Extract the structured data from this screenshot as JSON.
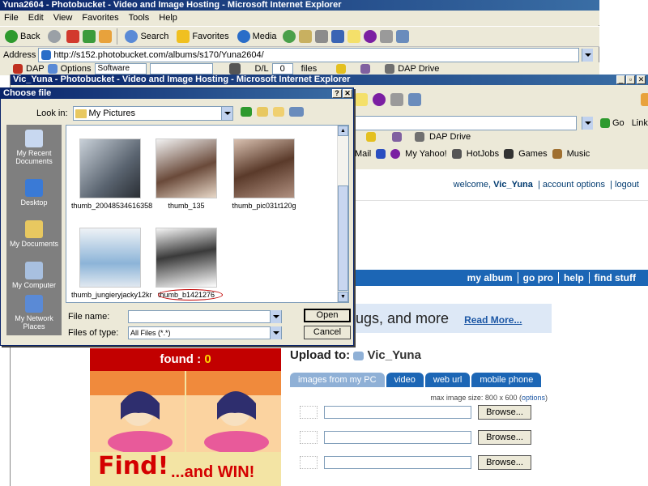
{
  "back_window": {
    "title": "Yuna2604 - Photobucket - Video and Image Hosting - Microsoft Internet Explorer",
    "menu": [
      "File",
      "Edit",
      "View",
      "Favorites",
      "Tools",
      "Help"
    ],
    "toolbar": {
      "back": "Back",
      "search": "Search",
      "favorites": "Favorites",
      "media": "Media"
    },
    "address_label": "Address",
    "address_url": "http://s152.photobucket.com/albums/s170/Yuna2604/",
    "links_bar": {
      "dap": "DAP",
      "options": "Options",
      "software": "Software",
      "dl": "D/L",
      "dl_count": "0",
      "files": "files",
      "dap_drive": "DAP Drive"
    }
  },
  "front_window": {
    "title": "Vic_Yuna - Photobucket - Video and Image Hosting - Microsoft Internet Explorer",
    "go": "Go",
    "links": "Links",
    "dap_drive": "DAP Drive",
    "favorites_bar": [
      "Mail",
      "My Yahoo!",
      "HotJobs",
      "Games",
      "Music"
    ],
    "page": {
      "welcome": "welcome,",
      "username": "Vic_Yuna",
      "account_options": "account options",
      "logout": "logout",
      "nav": [
        "my album",
        "go pro",
        "help",
        "find stuff"
      ],
      "promo_text": "ugs, and more",
      "read_more": "Read More...",
      "game": {
        "found_label": "found :",
        "found_count": "0",
        "find": "Find!",
        "win": "...and WIN!"
      },
      "upload": {
        "heading": "Upload to:",
        "target": "Vic_Yuna",
        "tabs": [
          "images from my PC",
          "video",
          "web url",
          "mobile phone"
        ],
        "max_size": "max image size: 800 x 600 (",
        "options_link": "options",
        "max_size_end": ")",
        "browse": "Browse..."
      }
    }
  },
  "dialog": {
    "title": "Choose file",
    "look_in_label": "Look in:",
    "look_in_value": "My Pictures",
    "places": [
      "My Recent Documents",
      "Desktop",
      "My Documents",
      "My Computer",
      "My Network Places"
    ],
    "files": [
      "thumb_20048534616358",
      "thumb_135",
      "thumb_pic031t120g",
      "thumb_jungieryjacky12kr",
      "thumb_b1421276"
    ],
    "file_name_label": "File name:",
    "file_name_value": "",
    "files_of_type_label": "Files of type:",
    "files_of_type_value": "All Files (*.*)",
    "open": "Open",
    "cancel": "Cancel"
  },
  "colors": {
    "titlebar": "#0a246a",
    "chrome": "#ece9d8",
    "photobucket_blue": "#1c66b5",
    "game_red": "#c20000",
    "selection_circle": "#c00000"
  }
}
